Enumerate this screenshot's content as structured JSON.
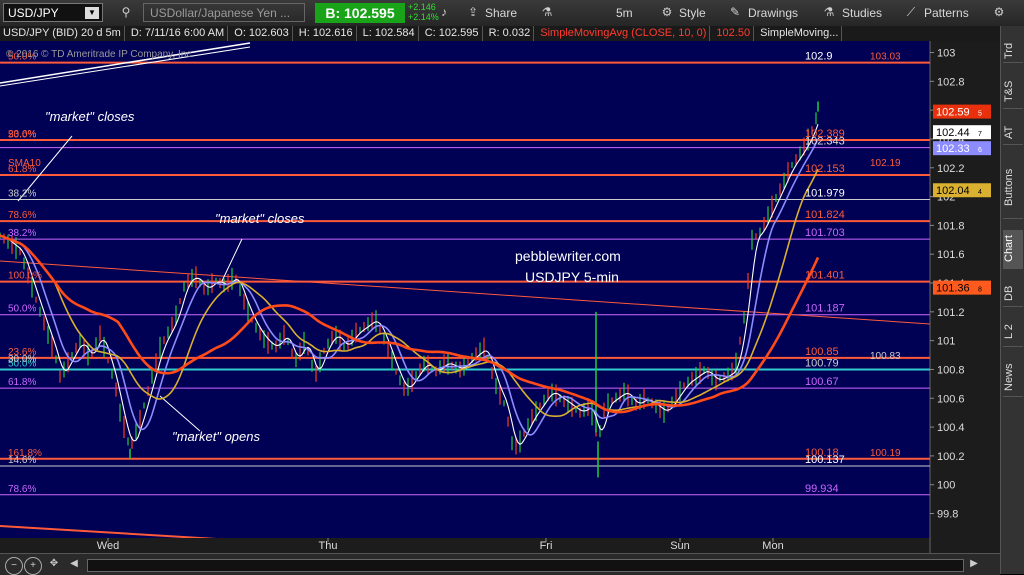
{
  "toolbar": {
    "symbol": "USD/JPY",
    "description": "USDollar/Japanese Yen ...",
    "bid": "B: 102.595",
    "change_abs": "+2.146",
    "change_pct": "+2.14%",
    "share_label": "Share",
    "interval": "5m",
    "style_label": "Style",
    "drawings_label": "Drawings",
    "studies_label": "Studies",
    "patterns_label": "Patterns"
  },
  "infobar": {
    "symbol_period": "USD/JPY (BID) 20 d 5m",
    "datetime": "D: 7/11/16 6:00 AM",
    "open": "O: 102.603",
    "high": "H: 102.616",
    "low": "L: 102.584",
    "close": "C: 102.595",
    "range": "R: 0.032",
    "sma": "SimpleMovingAvg (CLOSE, 10, 0)",
    "sma_value": "102.50",
    "sma_more": "SimpleMoving..."
  },
  "copyright": "© 2016 © TD Ameritrade IP Company, Inc.",
  "sidebar_tabs": [
    "Trd",
    "T&S",
    "AT",
    "Buttons",
    "Chart",
    "DB",
    "L 2",
    "News"
  ],
  "sidebar_active": "Chart",
  "chart_data": {
    "type": "line",
    "annotations": [
      "\"market\" closes",
      "\"market\" closes",
      "\"market\" opens",
      "pebblewriter.com",
      "USDJPY 5-min"
    ],
    "x_labels": [
      "Wed",
      "Thu",
      "Fri",
      "Sun",
      "Mon"
    ],
    "y_ticks": [
      103,
      102.8,
      102.6,
      102.4,
      102.2,
      102,
      101.8,
      101.6,
      101.4,
      101.2,
      101,
      100.8,
      100.6,
      100.4,
      100.2,
      100,
      99.8
    ],
    "ylim": [
      99.63,
      103.08
    ],
    "price_tags": [
      {
        "value": 102.59,
        "text": "102.59",
        "sup": "5",
        "bg": "#e8310c",
        "fg": "#ffffff"
      },
      {
        "value": 102.447,
        "text": "102.44",
        "sup": "7",
        "bg": "#ffffff",
        "fg": "#000000"
      },
      {
        "value": 102.336,
        "text": "102.33",
        "sup": "6",
        "bg": "#8c8cff",
        "fg": "#ffffff"
      },
      {
        "value": 102.044,
        "text": "102.04",
        "sup": "4",
        "bg": "#d9b030",
        "fg": "#000000"
      },
      {
        "value": 101.368,
        "text": "101.36",
        "sup": "8",
        "bg": "#ff5a1e",
        "fg": "#000000"
      }
    ],
    "levels": [
      {
        "value": 102.93,
        "color": "#ff5a3a",
        "width": 2,
        "left": "50.0%",
        "right": "102.9",
        "label_color": "#ffffff"
      },
      {
        "value": 102.393,
        "color": "#ff5a3a",
        "width": 2,
        "left": "23.6%",
        "right": "102.389",
        "label_color": "#ff5a3a"
      },
      {
        "value": 102.34,
        "color": "#cc66ff",
        "width": 1,
        "left": "",
        "right": "102.343",
        "label_color": "#dddddd"
      },
      {
        "value": 102.15,
        "color": "#ff5a3a",
        "width": 2,
        "left": "61.8%",
        "right": "102.153",
        "label_color": "#ff5a3a"
      },
      {
        "value": 101.98,
        "color": "#cccccc",
        "width": 1,
        "left": "38.2%",
        "right": "101.979",
        "label_color": "#ffffff"
      },
      {
        "value": 101.83,
        "color": "#ff5a3a",
        "width": 2,
        "left": "78.6%",
        "right": "101.824",
        "label_color": "#ff5a3a"
      },
      {
        "value": 101.705,
        "color": "#cc66ff",
        "width": 1,
        "left": "38.2%",
        "right": "101.703",
        "label_color": "#cc66ff"
      },
      {
        "value": 101.41,
        "color": "#ff5a3a",
        "width": 2,
        "left": "100.0%",
        "right": "101.401",
        "label_color": "#ff5a3a"
      },
      {
        "value": 101.18,
        "color": "#cc66ff",
        "width": 1,
        "left": "50.0%",
        "right": "101.187",
        "label_color": "#cc66ff"
      },
      {
        "value": 100.88,
        "color": "#ff5a3a",
        "width": 2,
        "left": "23.6%",
        "right": "100.85",
        "label_color": "#ff5a3a"
      },
      {
        "value": 100.8,
        "color": "#33cccc",
        "width": 2,
        "left": "50.0%",
        "right": "100.79",
        "label_color": "#cccccc"
      },
      {
        "value": 100.67,
        "color": "#cc66ff",
        "width": 1,
        "left": "61.8%",
        "right": "100.67",
        "label_color": "#cc66ff"
      },
      {
        "value": 100.18,
        "color": "#ff5a3a",
        "width": 2,
        "left": "161.8%",
        "right": "100.18",
        "label_color": "#ff5a3a"
      },
      {
        "value": 100.13,
        "color": "#cccccc",
        "width": 1,
        "left": "14.6%",
        "right": "100.137",
        "label_color": "#ffffff"
      },
      {
        "value": 99.93,
        "color": "#cc66ff",
        "width": 1,
        "left": "78.6%",
        "right": "99.934",
        "label_color": "#cc66ff"
      }
    ],
    "extra_labels": [
      {
        "value": 102.39,
        "text": "50.0%",
        "color": "#ff5a3a",
        "where": "left"
      },
      {
        "value": 102.19,
        "text": "SMA10",
        "color": "#ff5a3a",
        "where": "left"
      },
      {
        "value": 102.19,
        "text": "102.19",
        "color": "#ff5a3a",
        "where": "right"
      },
      {
        "value": 102.93,
        "text": "103.03",
        "color": "#ff5a3a",
        "where": "right"
      },
      {
        "value": 100.83,
        "text": "30.0%",
        "color": "#cccccc",
        "where": "left"
      },
      {
        "value": 100.18,
        "text": "100.19",
        "color": "#ff5a3a",
        "where": "right"
      },
      {
        "value": 100.85,
        "text": "100.83",
        "color": "#cccccc",
        "where": "right"
      }
    ],
    "series": [
      {
        "name": "SMA 10",
        "color": "#ffffff"
      },
      {
        "name": "SMA 20",
        "color": "#8c8cff"
      },
      {
        "name": "SMA 50",
        "color": "#d9b030"
      },
      {
        "name": "SMA 100",
        "color": "#ff4a1a"
      }
    ],
    "price": [
      [
        0,
        101.73
      ],
      [
        20,
        101.62
      ],
      [
        40,
        101.2
      ],
      [
        55,
        100.9
      ],
      [
        60,
        100.75
      ],
      [
        80,
        101.0
      ],
      [
        90,
        100.88
      ],
      [
        100,
        101.05
      ],
      [
        115,
        100.7
      ],
      [
        120,
        100.5
      ],
      [
        130,
        100.25
      ],
      [
        140,
        100.45
      ],
      [
        150,
        100.7
      ],
      [
        160,
        100.95
      ],
      [
        175,
        101.15
      ],
      [
        185,
        101.4
      ],
      [
        195,
        101.45
      ],
      [
        205,
        101.35
      ],
      [
        215,
        101.42
      ],
      [
        225,
        101.38
      ],
      [
        235,
        101.45
      ],
      [
        245,
        101.25
      ],
      [
        255,
        101.1
      ],
      [
        265,
        101.0
      ],
      [
        275,
        100.95
      ],
      [
        285,
        101.05
      ],
      [
        295,
        100.85
      ],
      [
        305,
        101.0
      ],
      [
        315,
        100.75
      ],
      [
        325,
        100.95
      ],
      [
        335,
        101.05
      ],
      [
        345,
        100.95
      ],
      [
        355,
        101.05
      ],
      [
        365,
        101.1
      ],
      [
        375,
        101.15
      ],
      [
        385,
        101.0
      ],
      [
        395,
        100.8
      ],
      [
        405,
        100.65
      ],
      [
        415,
        100.75
      ],
      [
        425,
        100.85
      ],
      [
        435,
        100.78
      ],
      [
        445,
        100.85
      ],
      [
        460,
        100.8
      ],
      [
        475,
        100.9
      ],
      [
        485,
        100.95
      ],
      [
        495,
        100.7
      ],
      [
        505,
        100.55
      ],
      [
        513,
        100.25
      ],
      [
        520,
        100.3
      ],
      [
        530,
        100.45
      ],
      [
        540,
        100.55
      ],
      [
        550,
        100.65
      ],
      [
        560,
        100.6
      ],
      [
        570,
        100.55
      ],
      [
        580,
        100.5
      ],
      [
        590,
        100.55
      ],
      [
        598,
        100.3
      ],
      [
        605,
        100.55
      ],
      [
        615,
        100.6
      ],
      [
        625,
        100.65
      ],
      [
        635,
        100.55
      ],
      [
        645,
        100.6
      ],
      [
        655,
        100.55
      ],
      [
        665,
        100.5
      ],
      [
        675,
        100.6
      ],
      [
        685,
        100.7
      ],
      [
        695,
        100.75
      ],
      [
        705,
        100.8
      ],
      [
        715,
        100.72
      ],
      [
        725,
        100.75
      ],
      [
        735,
        100.8
      ],
      [
        745,
        101.2
      ],
      [
        752,
        101.7
      ],
      [
        760,
        101.75
      ],
      [
        770,
        101.9
      ],
      [
        780,
        102.05
      ],
      [
        790,
        102.2
      ],
      [
        800,
        102.3
      ],
      [
        810,
        102.42
      ],
      [
        815,
        102.52
      ],
      [
        818,
        102.59
      ]
    ],
    "price_spikes": [
      [
        130,
        100.18
      ],
      [
        598,
        100.05
      ],
      [
        596,
        101.2
      ],
      [
        818,
        102.66
      ]
    ]
  }
}
